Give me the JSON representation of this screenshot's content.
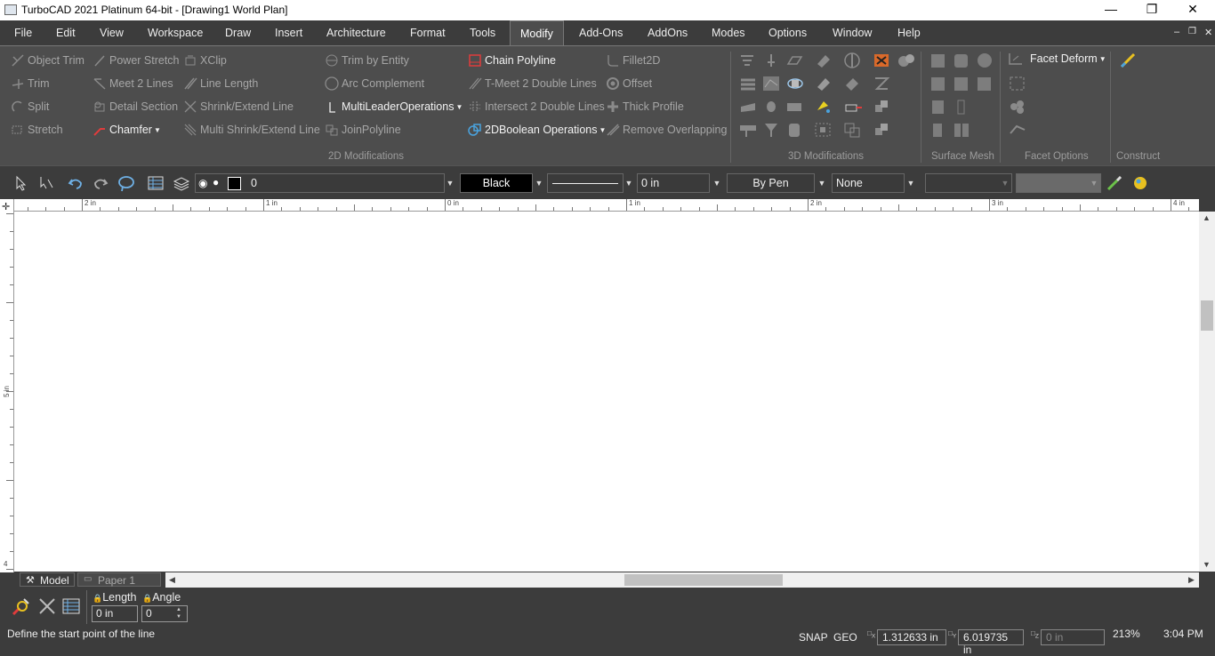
{
  "window": {
    "title": "TurboCAD 2021 Platinum 64-bit - [Drawing1 World Plan]"
  },
  "menu": [
    "File",
    "Edit",
    "View",
    "Workspace",
    "Draw",
    "Insert",
    "Architecture",
    "Format",
    "Tools",
    "Modify",
    "Add-Ons",
    "AddOns",
    "Modes",
    "Options",
    "Window",
    "Help"
  ],
  "active_menu": "Modify",
  "ribbon": {
    "col1": [
      "Object Trim",
      "Trim",
      "Split",
      "Stretch"
    ],
    "col2": [
      "Power Stretch",
      "Meet 2 Lines",
      "Detail Section",
      "Chamfer"
    ],
    "col3": [
      "XClip",
      "Line Length",
      "Shrink/Extend Line",
      "Multi Shrink/Extend Line"
    ],
    "col4": [
      "Trim by Entity",
      "Arc Complement",
      "MultiLeaderOperations",
      "JoinPolyline"
    ],
    "col5": [
      "Chain Polyline",
      "T-Meet 2 Double Lines",
      "Intersect 2 Double Lines",
      "2DBoolean Operations"
    ],
    "col6": [
      "Fillet2D",
      "Offset",
      "Thick Profile",
      "Remove Overlapping"
    ],
    "facet_deform": "Facet Deform",
    "groups": {
      "mod2d": "2D Modifications",
      "mod3d": "3D Modifications",
      "surface": "Surface Mesh",
      "facet": "Facet Options",
      "construct": "Construct"
    }
  },
  "propbar": {
    "layer": "0",
    "color": "Black",
    "linewidth": "0 in",
    "pen": "By Pen",
    "fill": "None"
  },
  "ruler": {
    "h": [
      "2 in",
      "1 in",
      "0 in",
      "1 in",
      "2 in",
      "3 in",
      "4 in"
    ],
    "v": "5 in",
    "vb": "4"
  },
  "tabs": [
    "Model",
    "Paper 1"
  ],
  "inspector": {
    "length_label": "Length",
    "angle_label": "Angle",
    "length_value": "0 in",
    "angle_value": "0"
  },
  "status": {
    "prompt": "Define the start point of the line",
    "snap": "SNAP",
    "geo": "GEO",
    "x": "1.312633 in",
    "y": "6.019735 in",
    "z": "0 in",
    "zoom": "213%",
    "time": "3:04 PM"
  },
  "colors": {
    "bg": "#3c3c3c",
    "ribbon": "#4d4d4d",
    "canvas": "#ffffff",
    "accent_red": "#e03c3c",
    "accent_blue": "#4aa3df"
  }
}
